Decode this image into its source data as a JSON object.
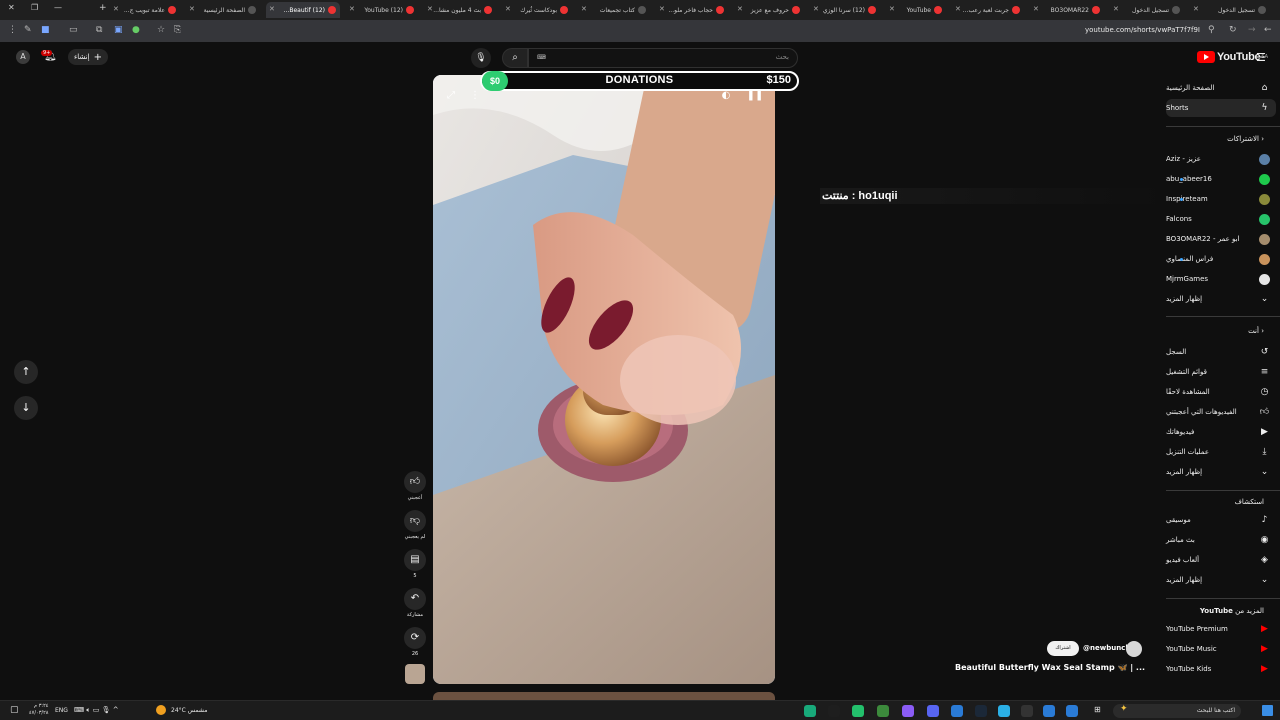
{
  "browser": {
    "tabs": [
      {
        "label": "علامة تبويب ج..."
      },
      {
        "label": "الصفحة الرئيسية"
      },
      {
        "label": "(12) Beautif..."
      },
      {
        "label": "(12) YouTube"
      },
      {
        "label": "بث 4 مليون مشا..."
      },
      {
        "label": "بودكاست ثُيرك"
      },
      {
        "label": "كتاب تجميعات"
      },
      {
        "label": "حجاب فاخر ملو..."
      },
      {
        "label": "حروف مع عزيز"
      },
      {
        "label": "(12) سرنا الوزي"
      },
      {
        "label": "YouTube"
      },
      {
        "label": "جربت لعبة رعب..."
      },
      {
        "label": "BO3OMAR22"
      },
      {
        "label": "تسجيل الدخول"
      },
      {
        "label": "تسجيل الدخول"
      }
    ],
    "url": "youtube.com/shorts/vwPaT7f7f9I"
  },
  "header": {
    "logo_text": "YouTube",
    "logo_region": "SA",
    "search_placeholder": "بحث",
    "keyboard_hint": "⌨",
    "create_label": "إنشاء",
    "avatar_letter": "A",
    "notification_count": "9+"
  },
  "sidebar": {
    "main": [
      {
        "label": "الصفحة الرئيسية",
        "icon": "home-icon"
      },
      {
        "label": "Shorts",
        "icon": "shorts-icon"
      }
    ],
    "subscriptions_title": "الاشتراكات",
    "subscriptions": [
      {
        "label": "عزيز - Aziz",
        "color": "#5a7fa6",
        "dot": false
      },
      {
        "label": "abu_abeer16",
        "color": "#1ec94c",
        "dot": true
      },
      {
        "label": "Inspireteam",
        "color": "#8a8a3a",
        "dot": true
      },
      {
        "label": "Falcons",
        "color": "#27c36a",
        "dot": false
      },
      {
        "label": "ابو عمر - BO3OMAR22",
        "color": "#a58d6d",
        "dot": false
      },
      {
        "label": "فراس المنصاوي",
        "color": "#c9935c",
        "dot": true
      },
      {
        "label": "MjrmGames",
        "color": "#e6e6e6",
        "dot": false
      },
      {
        "label": "إظهار المزيد",
        "color": "",
        "dot": false
      }
    ],
    "you_title": "أنت",
    "you": [
      {
        "label": "السجل",
        "icon": "history-icon"
      },
      {
        "label": "قوائم التشغيل",
        "icon": "playlists-icon"
      },
      {
        "label": "المشاهدة لاحقًا",
        "icon": "watch-later-icon"
      },
      {
        "label": "الفيديوهات التي أعجبتني",
        "icon": "liked-icon"
      },
      {
        "label": "فيديوهاتك",
        "icon": "your-videos-icon"
      },
      {
        "label": "عمليات التنزيل",
        "icon": "download-icon"
      },
      {
        "label": "إظهار المزيد",
        "icon": "chevron-down-icon"
      }
    ],
    "explore_title": "استكشاف",
    "explore": [
      {
        "label": "موسيقى",
        "icon": "music-icon"
      },
      {
        "label": "بث مباشر",
        "icon": "live-icon"
      },
      {
        "label": "ألعاب فيديو",
        "icon": "gaming-icon"
      },
      {
        "label": "إظهار المزيد",
        "icon": "chevron-down-icon"
      }
    ],
    "more_title": "المزيد من",
    "more_brand": "YouTube",
    "more": [
      {
        "label": "YouTube Premium"
      },
      {
        "label": "YouTube Music"
      },
      {
        "label": "YouTube Kids"
      }
    ]
  },
  "overlay": {
    "donation_current": "$0",
    "donation_title": "DONATIONS",
    "donation_goal": "$150",
    "chat_message": "منتتت : ho1uqii"
  },
  "actions": {
    "like_label": "أعجبني",
    "dislike_label": "لم يعجبني",
    "comments_count": "5",
    "share_label": "مشاركة",
    "remix_count": "26"
  },
  "video_info": {
    "channel_handle": "@newbunch",
    "subscribe_label": "اشتراك",
    "title": "Beautiful Butterfly Wax Seal Stamp 🦋 | ..."
  },
  "taskbar": {
    "search_placeholder": "اكتب هنا للبحث",
    "weather": "24°C مشمس",
    "language": "ENG",
    "time": "٣:٢٤ م",
    "date": "٤٧/٠٣/٢٨"
  },
  "colors": {
    "background": "#0f0f0f",
    "youtube_red": "#ff0000",
    "donation_green": "#2ecc71",
    "link_blue": "#3ea6ff"
  }
}
